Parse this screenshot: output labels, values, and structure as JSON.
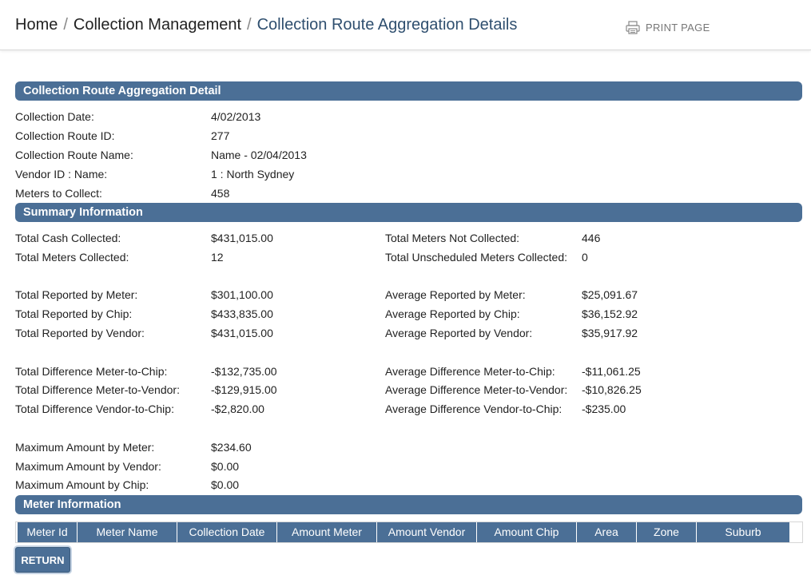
{
  "breadcrumb": {
    "home": "Home",
    "collection_management": "Collection Management",
    "current": "Collection Route Aggregation Details",
    "separator": "/"
  },
  "print": {
    "label": "PRINT PAGE",
    "icon": "printer-icon"
  },
  "detail": {
    "title": "Collection Route Aggregation Detail",
    "rows": [
      {
        "label": "Collection Date:",
        "value": "4/02/2013"
      },
      {
        "label": "Collection Route ID:",
        "value": "277"
      },
      {
        "label": "Collection Route Name:",
        "value": "Name - 02/04/2013"
      },
      {
        "label": "Vendor ID : Name:",
        "value": "1 : North Sydney"
      },
      {
        "label": "Meters to Collect:",
        "value": "458"
      }
    ]
  },
  "summary": {
    "title": "Summary Information",
    "left": [
      {
        "label": "Total Cash Collected:",
        "value": "$431,015.00"
      },
      {
        "label": "Total Meters Collected:",
        "value": "12"
      },
      {
        "label": "Total Reported by Meter:",
        "value": "$301,100.00"
      },
      {
        "label": "Total Reported by Chip:",
        "value": "$433,835.00"
      },
      {
        "label": "Total Reported by Vendor:",
        "value": "$431,015.00"
      },
      {
        "label": "Total Difference Meter-to-Chip:",
        "value": "-$132,735.00"
      },
      {
        "label": "Total Difference Meter-to-Vendor:",
        "value": "-$129,915.00"
      },
      {
        "label": "Total Difference Vendor-to-Chip:",
        "value": "-$2,820.00"
      },
      {
        "label": "Maximum Amount by Meter:",
        "value": "$234.60"
      },
      {
        "label": "Maximum Amount by Vendor:",
        "value": "$0.00"
      },
      {
        "label": "Maximum Amount by Chip:",
        "value": "$0.00"
      }
    ],
    "right": [
      {
        "label": "Total Meters Not Collected:",
        "value": "446"
      },
      {
        "label": "Total Unscheduled Meters Collected:",
        "value": "0"
      },
      {
        "label": "Average Reported by Meter:",
        "value": "$25,091.67"
      },
      {
        "label": "Average Reported by Chip:",
        "value": "$36,152.92"
      },
      {
        "label": "Average Reported by Vendor:",
        "value": "$35,917.92"
      },
      {
        "label": "Average Difference Meter-to-Chip:",
        "value": "-$11,061.25"
      },
      {
        "label": "Average Difference Meter-to-Vendor:",
        "value": "-$10,826.25"
      },
      {
        "label": "Average Difference Vendor-to-Chip:",
        "value": "-$235.00"
      }
    ]
  },
  "meter_info": {
    "title": "Meter Information",
    "columns": [
      "Meter Id",
      "Meter Name",
      "Collection Date",
      "Amount Meter",
      "Amount Vendor",
      "Amount Chip",
      "Area",
      "Zone",
      "Suburb"
    ]
  },
  "return_button": {
    "label": "RETURN"
  },
  "colors": {
    "accent": "#4b6f96",
    "breadcrumb_current": "#2f4f6f"
  }
}
